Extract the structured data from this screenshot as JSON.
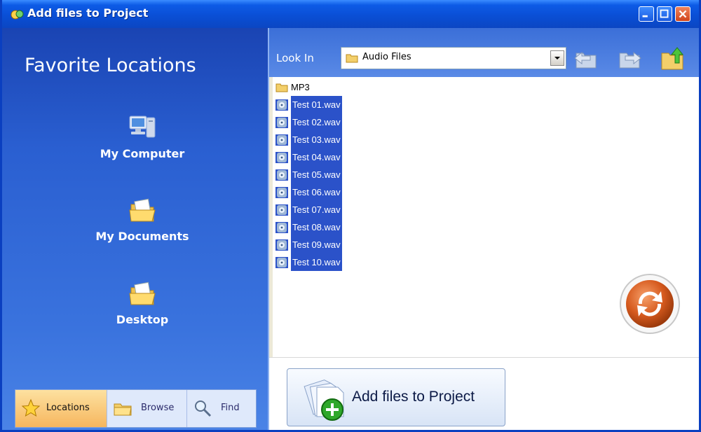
{
  "window": {
    "title": "Add files to Project"
  },
  "left_panel": {
    "heading": "Favorite Locations",
    "locations": [
      {
        "label": "My Computer",
        "icon": "computer-icon"
      },
      {
        "label": "My Documents",
        "icon": "folder-open-icon"
      },
      {
        "label": "Desktop",
        "icon": "folder-open-icon"
      }
    ],
    "tabs": [
      {
        "label": "Locations",
        "icon": "star-icon",
        "active": true
      },
      {
        "label": "Browse",
        "icon": "folder-icon",
        "active": false
      },
      {
        "label": "Find",
        "icon": "magnifier-icon",
        "active": false
      }
    ]
  },
  "toolbar": {
    "look_in_label": "Look In",
    "look_in_value": "Audio Files",
    "buttons": [
      "back-icon",
      "forward-icon",
      "up-folder-icon"
    ]
  },
  "files": [
    {
      "name": "MP3",
      "type": "folder",
      "selected": false
    },
    {
      "name": "Test 01.wav",
      "type": "wav",
      "selected": true
    },
    {
      "name": "Test 02.wav",
      "type": "wav",
      "selected": true
    },
    {
      "name": "Test 03.wav",
      "type": "wav",
      "selected": true
    },
    {
      "name": "Test 04.wav",
      "type": "wav",
      "selected": true
    },
    {
      "name": "Test 05.wav",
      "type": "wav",
      "selected": true
    },
    {
      "name": "Test 06.wav",
      "type": "wav",
      "selected": true
    },
    {
      "name": "Test 07.wav",
      "type": "wav",
      "selected": true
    },
    {
      "name": "Test 08.wav",
      "type": "wav",
      "selected": true
    },
    {
      "name": "Test 09.wav",
      "type": "wav",
      "selected": true
    },
    {
      "name": "Test 10.wav",
      "type": "wav",
      "selected": true
    }
  ],
  "add_button": {
    "label": "Add files to Project",
    "icon": "add-files-icon"
  },
  "colors": {
    "title_blue": "#0a4fd6",
    "panel_blue": "#2a5fd1",
    "selection": "#2b52c9",
    "active_tab": "#f6b65e"
  }
}
